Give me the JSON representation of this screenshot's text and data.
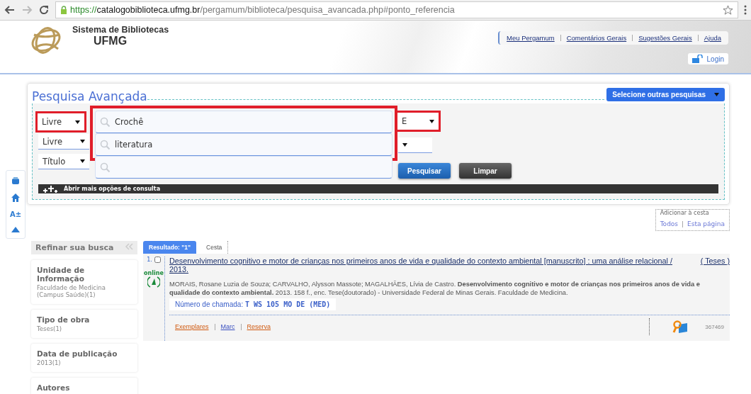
{
  "browser": {
    "url_secure": "https://",
    "url_host": "catalogobiblioteca.ufmg.br",
    "url_path": "/pergamum/biblioteca/pesquisa_avancada.php#ponto_referencia"
  },
  "header": {
    "title": "Sistema de Bibliotecas",
    "subtitle": "UFMG",
    "links": [
      "Meu Pergamum",
      "Comentários Gerais",
      "Sugestões Gerais",
      "Ajuda"
    ],
    "login": "Login"
  },
  "side_toolbar": {
    "font_label": "A±"
  },
  "search": {
    "legend": "Pesquisa Avançada",
    "other_searches": "Selecione outras pesquisas",
    "rows": [
      {
        "field": "Livre",
        "field_marked": true,
        "query": "Crochê",
        "query_marked": true,
        "op": "E",
        "op_marked": true
      },
      {
        "field": "Livre",
        "field_marked": false,
        "query": "literatura",
        "query_marked": true,
        "op_marked": false
      },
      {
        "field": "Título",
        "field_marked": false,
        "query_marked": false
      }
    ],
    "buttons": [
      "Pesquisar",
      "Limpar"
    ],
    "more_options": "Abrir mais opções de consulta"
  },
  "basket": {
    "label": "Adicionar à cesta",
    "links": [
      "Todos",
      "Esta página"
    ]
  },
  "refine": {
    "title": "Refinar sua busca",
    "facets": [
      {
        "name": "Unidade de Informação",
        "value": "Faculdade de Medicina (Campus Saúde)(1)"
      },
      {
        "name": "Tipo de obra",
        "value": "Teses(1)"
      },
      {
        "name": "Data de publicação",
        "value": "2013(1)"
      },
      {
        "name": "Autores"
      }
    ]
  },
  "tabs": [
    {
      "label": "Resultado: \"1\"",
      "selected": true
    },
    {
      "label": "Cesta",
      "selected": false
    }
  ],
  "results": [
    {
      "index": "1.",
      "checked": false,
      "title": "Desenvolvimento cognitivo e motor de crianças nos primeiros anos de vida e qualidade do contexto ambiental [manuscrito] : uma análise relacional / 2013.",
      "type": "( Teses )",
      "online_label": "online",
      "reference": "MORAIS, Rosane Luzia de Souza; CARVALHO, Alysson Massote; MAGALHÃES, Lívia de Castro. **Desenvolvimento cognitivo e motor de crianças nos primeiros anos de vida e qualidade do contexto ambiental.** 2013. 158 f., enc. Tese(doutorado) - Universidade Federal de Minas Gerais. Faculdade de Medicina.",
      "call_label": "Número de chamada:",
      "call_number": "T  WS 105 MO DE (MED)",
      "actions": [
        "Exemplares",
        "Marc",
        "Reserva"
      ],
      "record_id": "367469"
    }
  ]
}
